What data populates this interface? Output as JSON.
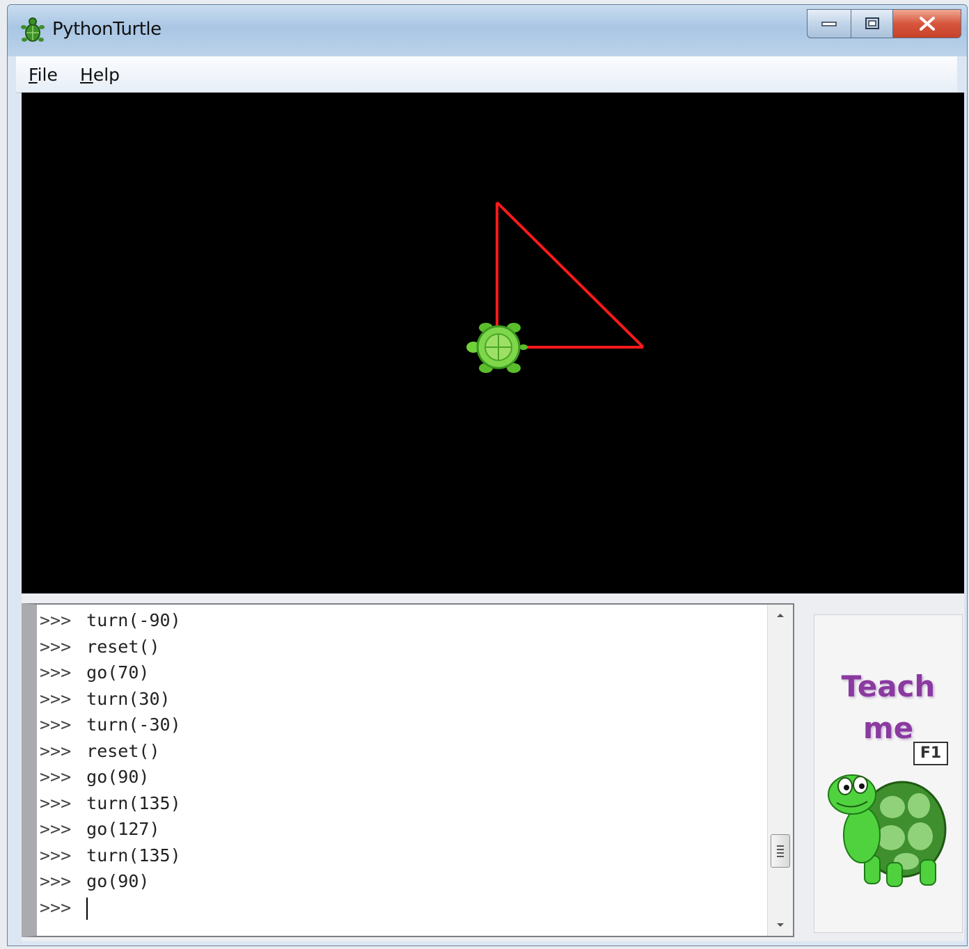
{
  "window": {
    "title": "PythonTurtle"
  },
  "menu": {
    "file": {
      "accel": "F",
      "rest": "ile"
    },
    "help": {
      "accel": "H",
      "rest": "elp"
    }
  },
  "colors": {
    "canvas_bg": "#000000",
    "pen": "#ff1a1a",
    "turtle": "#6fd23a",
    "teach_text": "#8a3aa0"
  },
  "icons": {
    "app": "turtle-icon",
    "minimize": "minimize-icon",
    "maximize": "maximize-icon",
    "close": "close-icon",
    "scroll_up": "chevron-up-icon",
    "scroll_down": "chevron-down-icon"
  },
  "shell": {
    "prompt": ">>>",
    "history": [
      "turn(-90)",
      "reset()",
      "go(70)",
      "turn(30)",
      "turn(-30)",
      "reset()",
      "go(90)",
      "turn(135)",
      "go(127)",
      "turn(135)",
      "go(90)"
    ],
    "current_input": ""
  },
  "teach": {
    "line1": "Teach",
    "line2": "me",
    "shortcut": "F1"
  }
}
